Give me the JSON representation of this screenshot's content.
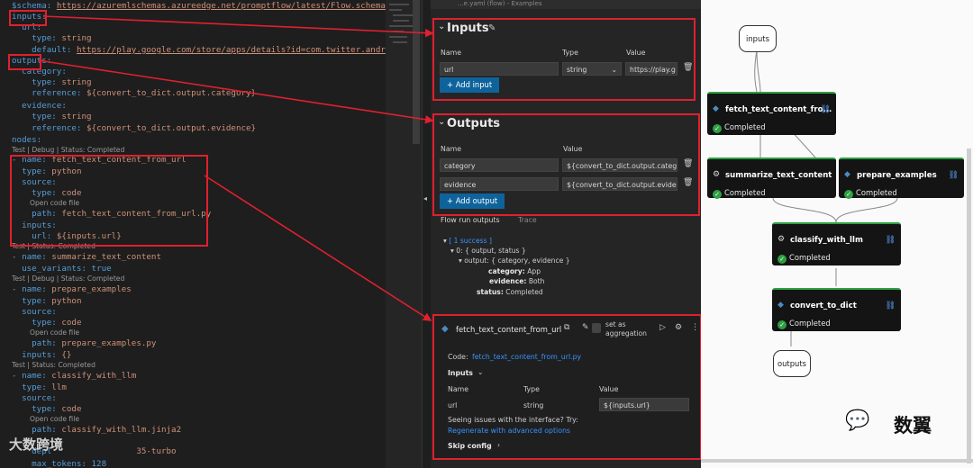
{
  "editor": {
    "l_schema_key": "$schema:",
    "l_schema_val": "https://azuremlschemas.azureedge.net/promptflow/latest/Flow.schema.json",
    "l_inputs": "inputs:",
    "l_url": "url:",
    "l_type1": "type:",
    "l_type1_val": "string",
    "l_default": "default:",
    "l_default_val": "https://play.google.com/store/apps/details?id=com.twitter.android",
    "l_outputs": "outputs:",
    "l_category": "category:",
    "l_type2": "type:",
    "l_type2_val": "string",
    "l_ref1": "reference:",
    "l_ref1_val": "${convert_to_dict.output.category}",
    "l_evidence": "evidence:",
    "l_type3": "type:",
    "l_type3_val": "string",
    "l_ref2": "reference:",
    "l_ref2_val": "${convert_to_dict.output.evidence}",
    "l_nodes": "nodes:",
    "lens1": "Test | Debug | Status: Completed",
    "l_n1_name": "- name:",
    "l_n1_val": "fetch_text_content_from_url",
    "l_n1_type": "type:",
    "l_n1_type_val": "python",
    "l_n1_source": "source:",
    "l_n1_stype": "type:",
    "l_n1_stype_val": "code",
    "lens_open1": "Open code file",
    "l_n1_path": "path:",
    "l_n1_path_val": "fetch_text_content_from_url.py",
    "l_n1_inputs": "inputs:",
    "l_n1_url": "url:",
    "l_n1_url_val": "${inputs.url}",
    "lens2": "Test | Status: Completed",
    "l_n2_name": "- name:",
    "l_n2_val": "summarize_text_content",
    "l_n2_uv": "use_variants:",
    "l_n2_uv_val": "true",
    "lens3": "Test | Debug | Status: Completed",
    "l_n3_name": "- name:",
    "l_n3_val": "prepare_examples",
    "l_n3_type": "type:",
    "l_n3_type_val": "python",
    "l_n3_source": "source:",
    "l_n3_stype": "type:",
    "l_n3_stype_val": "code",
    "lens_open2": "Open code file",
    "l_n3_path": "path:",
    "l_n3_path_val": "prepare_examples.py",
    "l_n3_inputs": "inputs:",
    "l_n3_inputs_val": "{}",
    "lens4": "Test | Status: Completed",
    "l_n4_name": "- name:",
    "l_n4_val": "classify_with_llm",
    "l_n4_type": "type:",
    "l_n4_type_val": "llm",
    "l_n4_source": "source:",
    "l_n4_stype": "type:",
    "l_n4_stype_val": "code",
    "lens_open3": "Open code file",
    "l_n4_path": "path:",
    "l_n4_path_val": "classify_with_llm.jinja2",
    "l_n4_dep_key": "depl",
    "l_n4_dep_val": "35-turbo",
    "l_n4_max": "max_tokens: 128"
  },
  "panel": {
    "tab_label": "...e.yaml (flow) - Examples",
    "inputs": {
      "title": "Inputs",
      "col_name": "Name",
      "col_type": "Type",
      "col_value": "Value",
      "row_name": "url",
      "row_type": "string",
      "row_value": "https://play.g",
      "add_label": "Add input"
    },
    "outputs": {
      "title": "Outputs",
      "col_name": "Name",
      "col_value": "Value",
      "rows": [
        {
          "name": "category",
          "value": "${convert_to_dict.output.catego"
        },
        {
          "name": "evidence",
          "value": "${convert_to_dict.output.eviden"
        }
      ],
      "add_label": "Add output"
    },
    "run_tabs": {
      "a": "Flow run outputs",
      "b": "Trace"
    },
    "tree": {
      "success": "[ 1 success ]",
      "item0": "0: { output, status }",
      "output": "output: { category, evidence }",
      "category_key": "category:",
      "category_val": "App",
      "evidence_key": "evidence:",
      "evidence_val": "Both",
      "status_key": "status:",
      "status_val": "Completed"
    },
    "node": {
      "title": "fetch_text_content_from_url",
      "aggregation": "set as aggregation",
      "code_label": "Code:",
      "code_file": "fetch_text_content_from_url.py",
      "inputs_label": "Inputs",
      "col_name": "Name",
      "col_type": "Type",
      "col_value": "Value",
      "row_name": "url",
      "row_type": "string",
      "row_value": "${inputs.url}",
      "issues": "Seeing issues with the interface? Try:",
      "regen": "Regenerate with advanced options",
      "skip": "Skip config"
    }
  },
  "dag": {
    "inputs": "inputs",
    "outputs": "outputs",
    "status": "Completed",
    "nodes": {
      "fetch": "fetch_text_content_fro...",
      "summarize": "summarize_text_content",
      "prepare": "prepare_examples",
      "classify": "classify_with_llm",
      "convert": "convert_to_dict"
    }
  },
  "watermarks": {
    "left": "大数跨境",
    "right": "数翼"
  },
  "colors": {
    "annotation_red": "#e0202e",
    "completed_green": "#2ea043",
    "button_blue": "#0e639c",
    "link_blue": "#3794ff"
  }
}
